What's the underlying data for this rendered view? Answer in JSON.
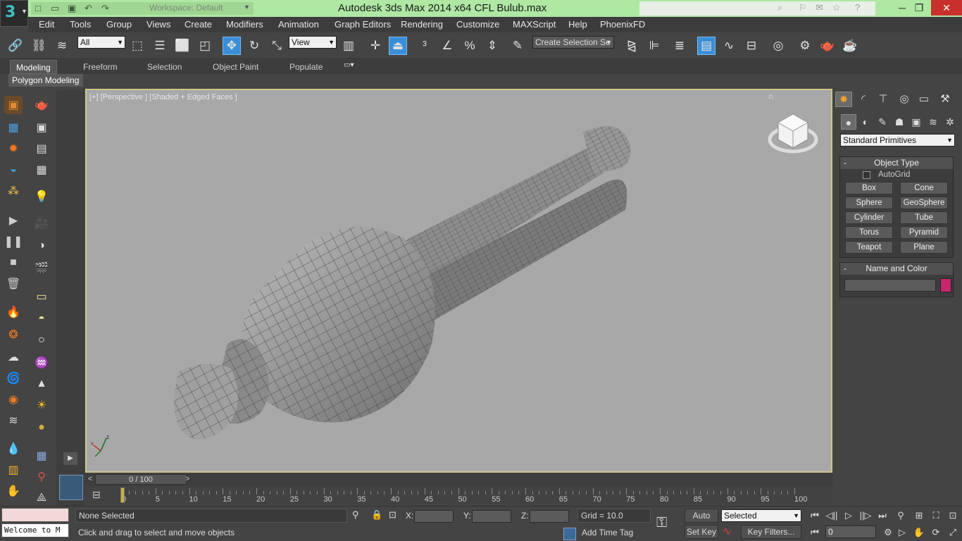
{
  "titlebar": {
    "workspace": "Workspace: Default",
    "title": "Autodesk 3ds Max  2014 x64      CFL Bulub.max"
  },
  "menu": [
    "Edit",
    "Tools",
    "Group",
    "Views",
    "Create",
    "Modifiers",
    "Animation",
    "Graph Editors",
    "Rendering",
    "Customize",
    "MAXScript",
    "Help",
    "PhoenixFD"
  ],
  "toolbar": {
    "selection_filter": "All",
    "ref_coord": "View",
    "named_selection": "Create Selection Se"
  },
  "ribbon": {
    "tabs": [
      "Modeling",
      "Freeform",
      "Selection",
      "Object Paint",
      "Populate"
    ],
    "active_tab": "Modeling",
    "panel_label": "Polygon Modeling"
  },
  "viewport": {
    "label": "[+] [Perspective ] [Shaded + Edged Faces ]"
  },
  "command_panel": {
    "category": "Standard Primitives",
    "object_type": {
      "header": "Object Type",
      "autogrid": "AutoGrid",
      "buttons": [
        "Box",
        "Cone",
        "Sphere",
        "GeoSphere",
        "Cylinder",
        "Tube",
        "Torus",
        "Pyramid",
        "Teapot",
        "Plane"
      ]
    },
    "name_color": {
      "header": "Name and Color",
      "name_value": "",
      "color": "#c8276e"
    }
  },
  "timeline": {
    "frame_display": "0 / 100",
    "ticks": [
      "0",
      "5",
      "10",
      "15",
      "20",
      "25",
      "30",
      "35",
      "40",
      "45",
      "50",
      "55",
      "60",
      "65",
      "70",
      "75",
      "80",
      "85",
      "90",
      "95",
      "100"
    ]
  },
  "status": {
    "script_listener": "Welcome to M",
    "selection": "None Selected",
    "prompt": "Click and drag to select and move objects",
    "x_label": "X:",
    "y_label": "Y:",
    "z_label": "Z:",
    "grid": "Grid = 10.0",
    "add_time_tag": "Add Time Tag",
    "auto_key": "Auto Key",
    "set_key": "Set Key",
    "key_mode": "Selected",
    "key_filters": "Key Filters...",
    "current_frame": "0"
  }
}
